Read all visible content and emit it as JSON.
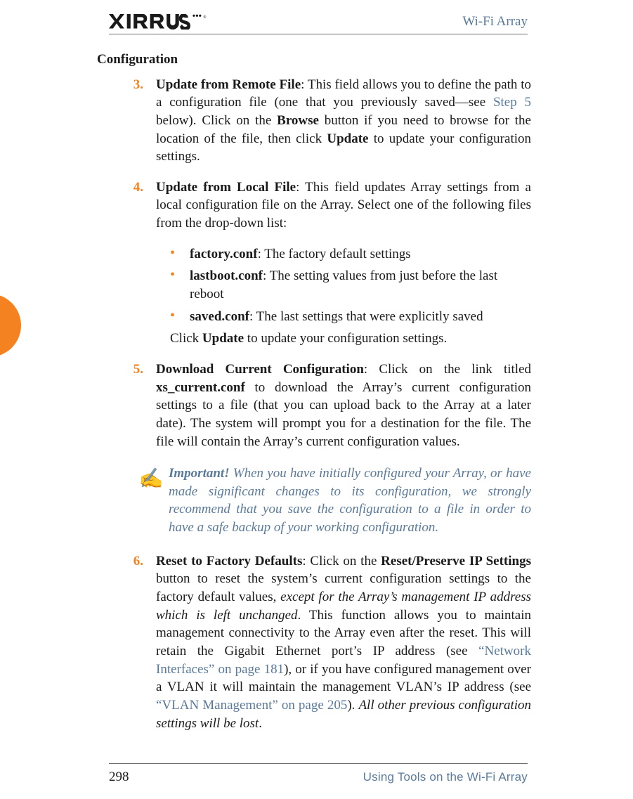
{
  "header": {
    "logo_alt": "XIRRUS",
    "doc_title": "Wi-Fi Array"
  },
  "section_title": "Configuration",
  "steps": {
    "s3": {
      "num": "3.",
      "title": "Update from Remote File",
      "t1": ": This field allows you to define the path to a configuration file (one that you previously saved—see ",
      "link": "Step 5",
      "t2": " below). Click on the ",
      "b1": "Browse",
      "t3": " button if you need to browse for the location of the file, then click ",
      "b2": "Update",
      "t4": " to update your configuration settings."
    },
    "s4": {
      "num": "4.",
      "title": "Update from Local File",
      "t1": ": This field updates Array settings from a local configuration file on the Array. Select one of the following files from the drop-down list:"
    },
    "s4_items": [
      {
        "name": "factory.conf",
        "desc": ": The factory default settings"
      },
      {
        "name": "lastboot.conf",
        "desc": ": The setting values from just before the last reboot"
      },
      {
        "name": "saved.conf",
        "desc": ": The last settings that were explicitly saved"
      }
    ],
    "s4_after_a": "Click ",
    "s4_after_b": "Update",
    "s4_after_c": " to update your configuration settings.",
    "s5": {
      "num": "5.",
      "title": "Download Current Configuration",
      "t1": ": Click on the link titled ",
      "b1": "xs_current.conf",
      "t2": " to download the Array’s current configuration settings to a file (that you can upload back to the Array at a later date). The system will prompt you for a destination for the file. The file will contain the Array’s current configuration values."
    },
    "callout": {
      "lead": "Important!",
      "body": " When you have initially configured your Array, or have made significant changes to its configuration, we strongly recommend that you save the configuration to a file in order to have a safe backup of your working configuration."
    },
    "s6": {
      "num": "6.",
      "title": "Reset to Factory Defaults",
      "t1": ": Click on the ",
      "b1": "Reset/Preserve IP Settings",
      "t2": " button to reset the system’s current configuration settings to the factory default values, ",
      "em1": "except for the Array’s management IP address which is left unchanged",
      "t3": ". This function allows you to maintain management connectivity to the Array even after the reset. This will retain the Gigabit Ethernet port’s IP address (see ",
      "link1": "“Network Interfaces” on page 181",
      "t4": "), or if you have configured management over a VLAN it will maintain the management VLAN’s IP address (see ",
      "link2": "“VLAN Management” on page 205",
      "t5": "). ",
      "em2": "All other previous configuration settings will be lost",
      "t6": "."
    }
  },
  "footer": {
    "page": "298",
    "text": "Using Tools on the Wi-Fi Array"
  }
}
